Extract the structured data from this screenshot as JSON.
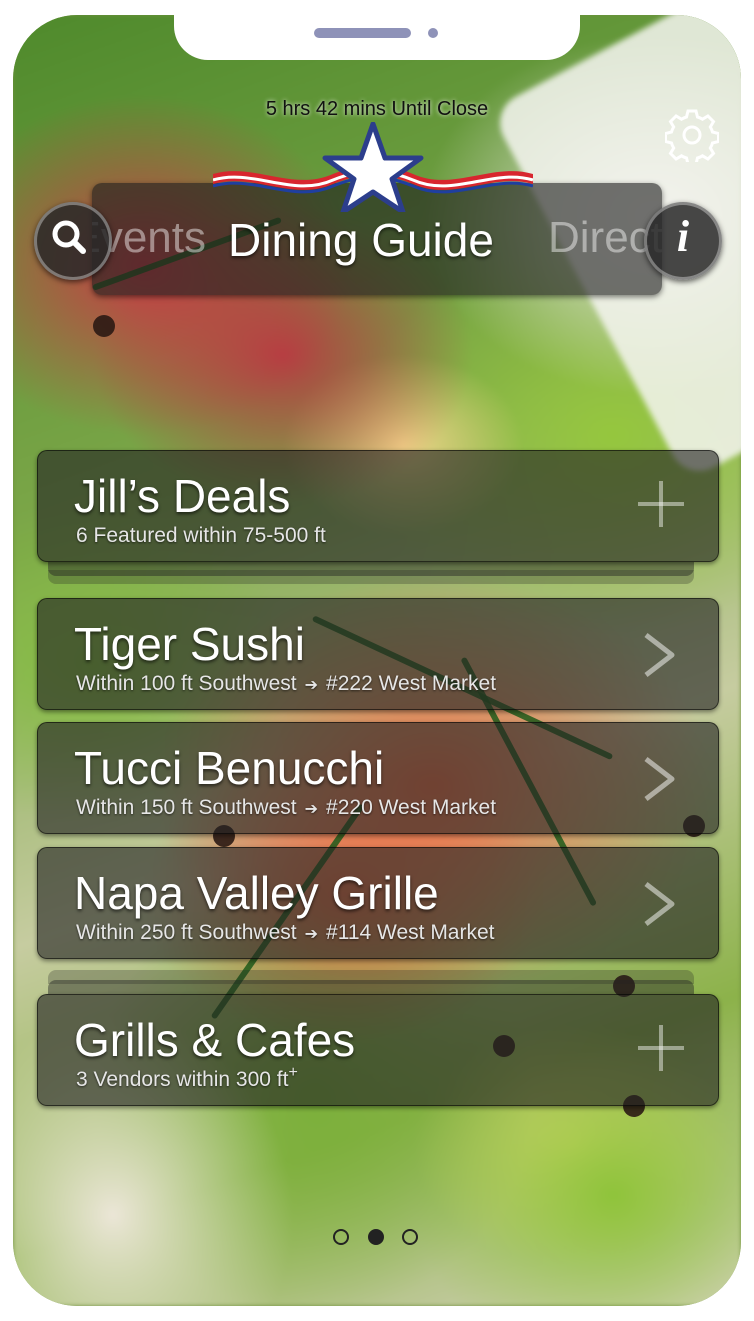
{
  "status": {
    "countdown": "5 hrs 42 mins Until Close"
  },
  "header": {
    "title_prev": "Events",
    "title": "Dining Guide",
    "title_next": "Directory"
  },
  "icons": {
    "settings": "gear-icon",
    "search": "search-icon",
    "info": "info-icon",
    "logo": "star-ribbon-logo"
  },
  "info_label": "i",
  "deals": {
    "name": "Jill’s Deals",
    "subtitle": "6 Featured within 75-500 ft"
  },
  "restaurants": [
    {
      "name": "Tiger Sushi",
      "distance": "Within 100 ft Southwest",
      "arrow": "➔",
      "location": "#222 West Market"
    },
    {
      "name": "Tucci Benucchi",
      "distance": "Within 150 ft Southwest",
      "arrow": "➔",
      "location": "#220 West Market"
    },
    {
      "name": "Napa Valley Grille",
      "distance": "Within 250 ft Southwest",
      "arrow": "➔",
      "location": "#114 West Market"
    }
  ],
  "category": {
    "name": "Grills & Cafes",
    "subtitle": "3 Vendors within 300 ft",
    "subtitle_sup": "+"
  },
  "pagination": {
    "pages": 3,
    "current": 2
  },
  "colors": {
    "star_white": "#ffffff",
    "star_blue": "#2c3e8c",
    "ribbon_red": "#d8262e",
    "ribbon_blue": "#1f3fa0"
  }
}
